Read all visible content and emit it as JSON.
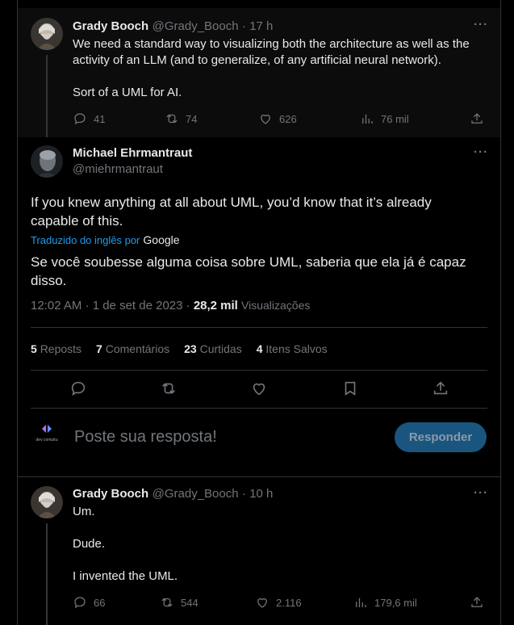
{
  "parent": {
    "name": "Grady Booch",
    "handle": "@Grady_Booch",
    "time": "· 17 h",
    "lines": [
      "We need a standard way to visualizing both the architecture as well as the",
      "activity of an LLM (and to generalize, of any artificial neural network)."
    ],
    "line2": "Sort of a UML for AI.",
    "replies": "41",
    "reposts": "74",
    "likes": "626",
    "views": "76 mil"
  },
  "main": {
    "name": "Michael Ehrmantraut",
    "handle": "@miehrmantraut",
    "text_lines": [
      "If you knew anything at all about UML, you’d know that it’s already",
      "capable of this."
    ],
    "translated_label": "Traduzido do inglês por",
    "translator": "Google",
    "translation_lines": [
      "Se você soubesse alguma coisa sobre UML, saberia que ela já é capaz",
      "disso."
    ],
    "timestamp": "12:02 AM · 1 de set de 2023 ·",
    "views_count": "28,2 mil",
    "views_label": "Visualizações",
    "stats": [
      {
        "count": "5",
        "label": "Reposts"
      },
      {
        "count": "7",
        "label": "Comentários"
      },
      {
        "count": "23",
        "label": "Curtidas"
      },
      {
        "count": "4",
        "label": "Itens Salvos"
      }
    ]
  },
  "composer": {
    "placeholder": "Poste sua resposta!",
    "button": "Responder",
    "avatar_text": "dev comuitu"
  },
  "reply": {
    "name": "Grady Booch",
    "handle": "@Grady_Booch",
    "time": "· 10 h",
    "line1": "Um.",
    "line2": "Dude.",
    "line3": "I invented the UML.",
    "replies": "66",
    "reposts": "544",
    "likes": "2.116",
    "views": "179,6 mil"
  },
  "colors": {
    "accent": "#1d9bf0",
    "reply_button_bg": "#1a5580",
    "border": "#2f3336",
    "muted_text": "#71767b"
  }
}
